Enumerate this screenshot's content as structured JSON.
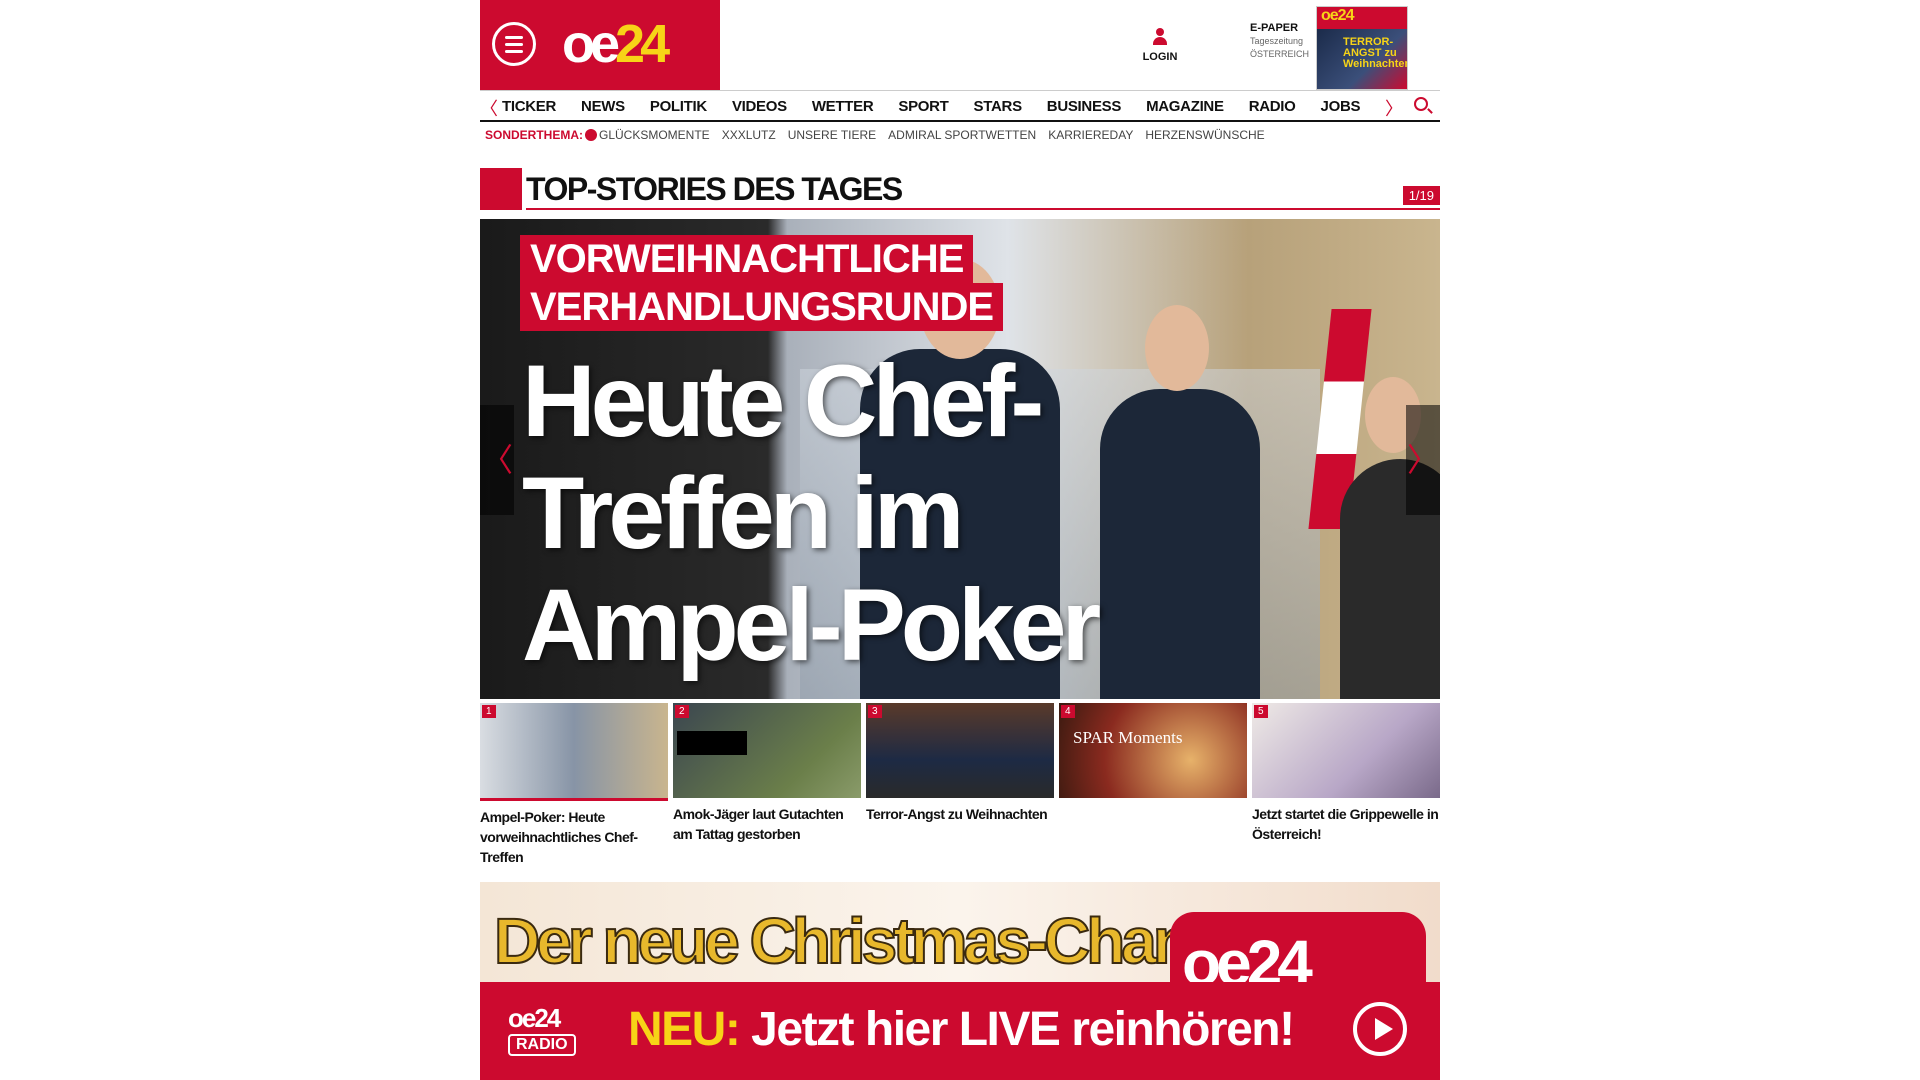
{
  "header": {
    "brand_main": "oe",
    "brand_num": "24",
    "login_label": "LOGIN",
    "epaper_title": "E-PAPER",
    "epaper_sub1": "Tageszeitung",
    "epaper_sub2": "ÖSTERREICH",
    "cover_brand": "oe24",
    "cover_headline": "TERROR-ANGST zu Weihnachten"
  },
  "nav": {
    "items": [
      "TICKER",
      "NEWS",
      "POLITIK",
      "VIDEOS",
      "WETTER",
      "SPORT",
      "STARS",
      "BUSINESS",
      "MAGAZINE",
      "RADIO",
      "JOBS"
    ],
    "prev": "〈",
    "next": "〉"
  },
  "subnav": {
    "lead": "SONDERTHEMA:",
    "items": [
      "GLÜCKSMOMENTE",
      "XXXLUTZ",
      "UNSERE TIERE",
      "ADMIRAL SPORTWETTEN",
      "KARRIEREDAY",
      "HERZENSWÜNSCHE"
    ]
  },
  "section": {
    "title": "TOP-STORIES DES TAGES",
    "counter": "1/19"
  },
  "hero": {
    "kicker1": "VORWEIHNACHTLICHE",
    "kicker2": "VERHANDLUNGSRUNDE",
    "headline": "Heute Chef-\nTreffen im\nAmpel-Poker",
    "prev": "〈",
    "next": "〉"
  },
  "thumbs": [
    {
      "no": "1",
      "caption": "Ampel-Poker: Heute vorweihnachtliches Chef-Treffen"
    },
    {
      "no": "2",
      "caption": "Amok-Jäger laut Gutachten am Tattag gestorben"
    },
    {
      "no": "3",
      "caption": "Terror-Angst zu Weihnachten"
    },
    {
      "no": "4",
      "caption": "",
      "image_text": "SPAR Moments"
    },
    {
      "no": "5",
      "caption": "Jetzt startet die Grippewelle in Österreich!"
    }
  ],
  "banner": {
    "channel": "Der neue Christmas-Channel",
    "pill_brand": "oe24",
    "radio_brand": "oe24",
    "radio_label": "RADIO",
    "cta_neu": "NEU:",
    "cta_text": "Jetzt hier LIVE reinhören!"
  }
}
